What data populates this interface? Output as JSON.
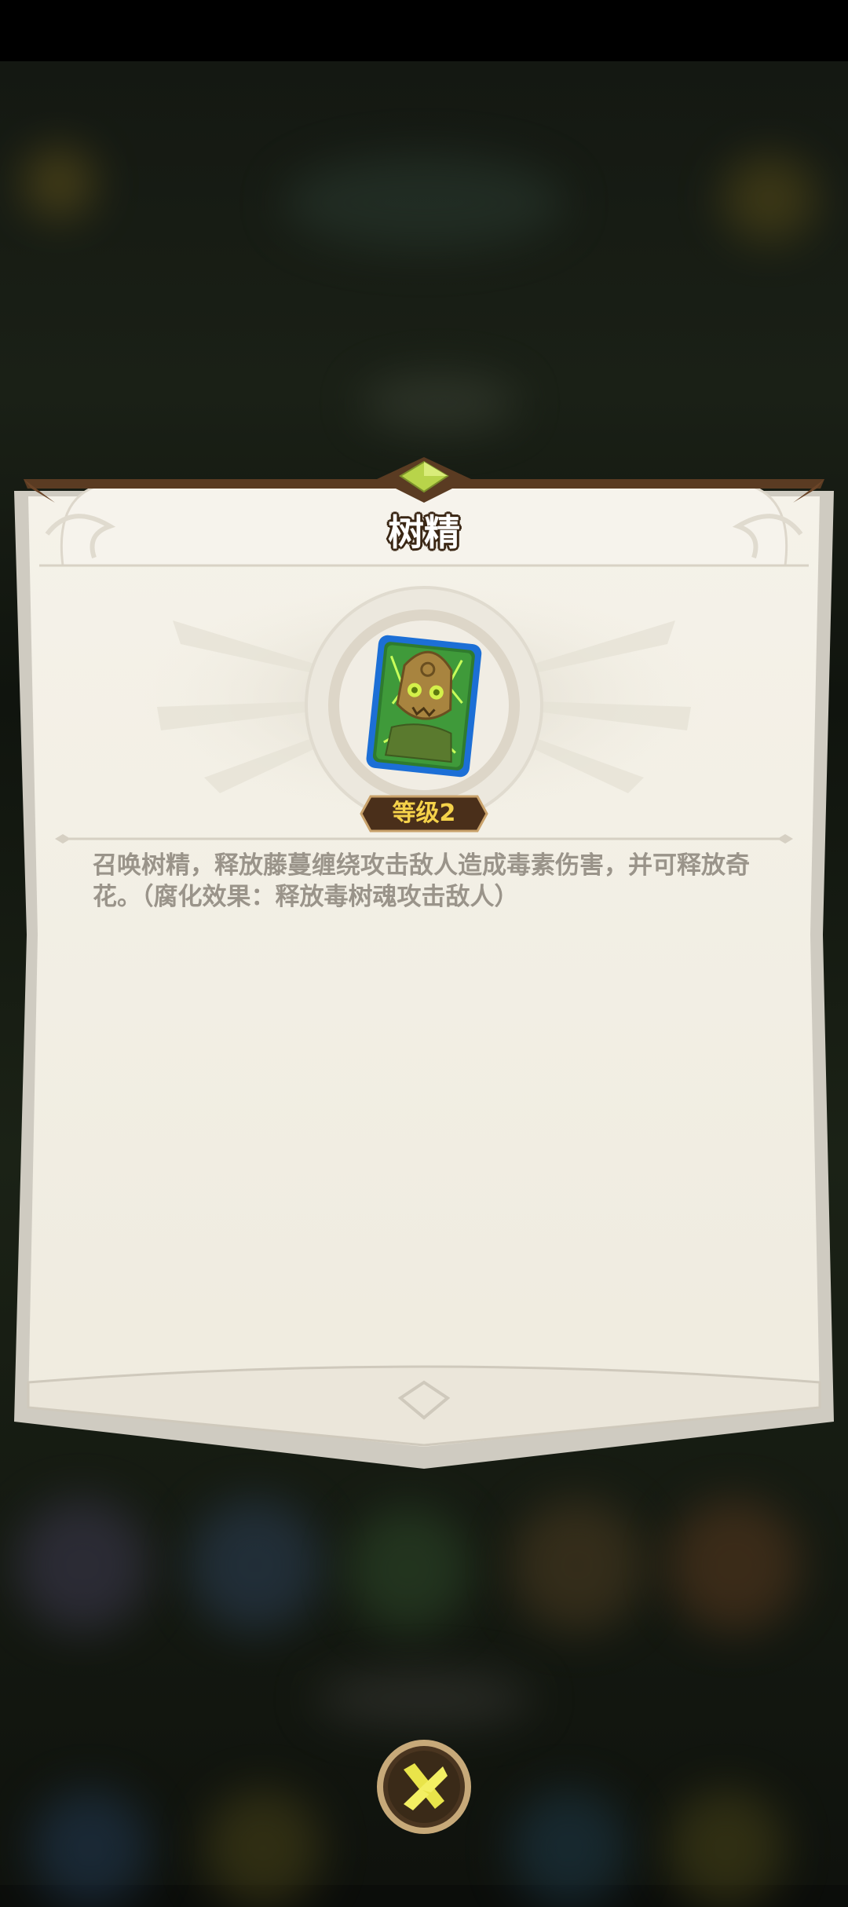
{
  "dialog": {
    "title": "树精",
    "level_label": "等级2",
    "description": "召唤树精，释放藤蔓缠绕攻击敌人造成毒素伤害，并可释放奇花。（腐化效果：释放毒树魂攻击敌人）"
  },
  "close_button": {
    "icon": "close-x-icon"
  },
  "colors": {
    "parchment": "#f3f0e6",
    "frame_brown": "#5a3b22",
    "level_text": "#f5d24a",
    "description_text": "#9a948a",
    "gem": "#b8d44a"
  }
}
